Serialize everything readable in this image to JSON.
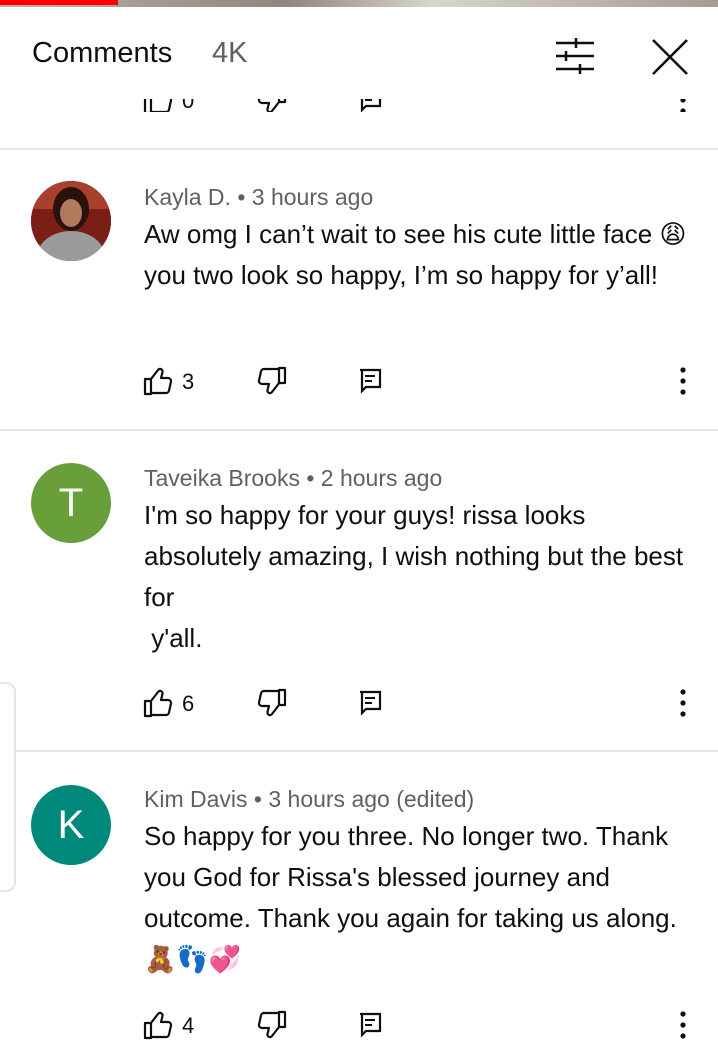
{
  "header": {
    "title": "Comments",
    "count": "4K",
    "filter_icon": "sort-filter-icon",
    "close_icon": "close-icon"
  },
  "partial_action_row": {
    "like_count": "0"
  },
  "comments": [
    {
      "author": "Kayla D.",
      "time": "3 hours ago",
      "meta": "Kayla D. • 3 hours ago",
      "text": "Aw omg I can’t wait to see his cute little face 😩 you two look so happy, I’m so happy for y’all!",
      "likes": "3",
      "avatar_type": "photo"
    },
    {
      "author": "Taveika Brooks",
      "time": "2 hours ago",
      "meta": "Taveika Brooks • 2 hours ago",
      "avatar_letter": "T",
      "avatar_color": "#689f38",
      "text": "I'm so happy for your guys! rissa looks absolutely amazing, I wish nothing but the best for\n y'all.",
      "likes": "6"
    },
    {
      "author": "Kim Davis",
      "time": "3 hours ago",
      "meta": "Kim Davis • 3 hours ago (edited)",
      "avatar_letter": "K",
      "avatar_color": "#00897b",
      "text": "So happy for you three. No longer two. Thank you God for Rissa's blessed journey and outcome. Thank you again for taking us along. 🧸👣💞",
      "likes": "4"
    }
  ]
}
